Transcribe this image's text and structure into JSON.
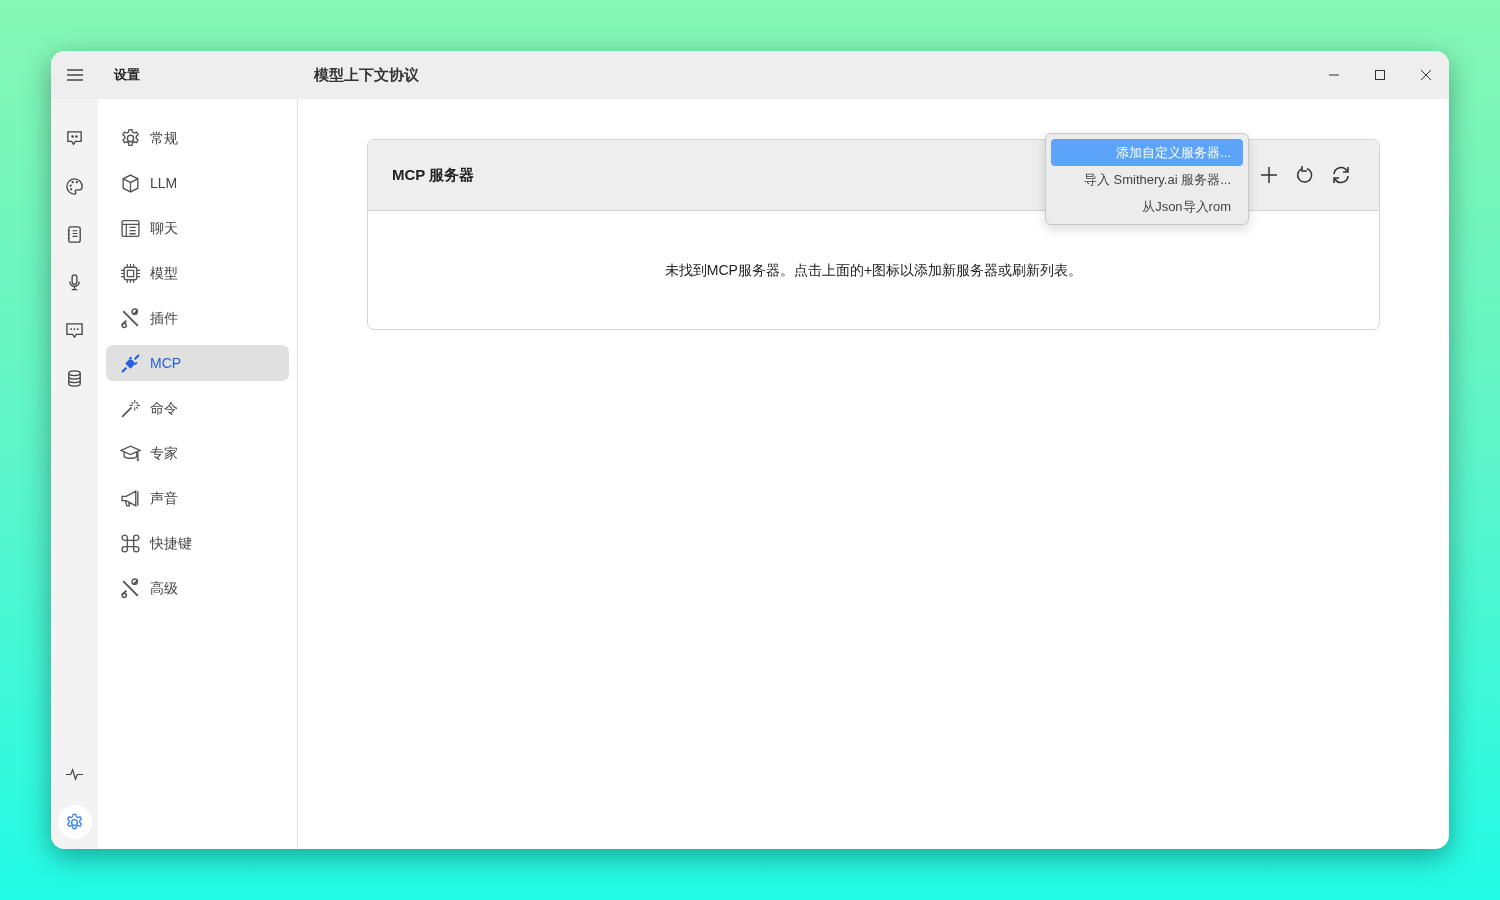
{
  "window": {
    "sidebar_title": "设置",
    "title": "模型上下文协议"
  },
  "rail": {
    "top": [
      {
        "kind": "chat-quote",
        "selected": false
      },
      {
        "kind": "palette",
        "selected": false
      },
      {
        "kind": "notebook",
        "selected": false
      },
      {
        "kind": "mic",
        "selected": false
      },
      {
        "kind": "chat-dots",
        "selected": false
      },
      {
        "kind": "database",
        "selected": false
      }
    ],
    "bottom": [
      {
        "kind": "pulse",
        "selected": false
      },
      {
        "kind": "gear",
        "selected": true
      }
    ]
  },
  "sidebar": {
    "items": [
      {
        "label": "常规",
        "kind": "gear",
        "selected": false
      },
      {
        "label": "LLM",
        "kind": "cube",
        "selected": false
      },
      {
        "label": "聊天",
        "kind": "layout",
        "selected": false
      },
      {
        "label": "模型",
        "kind": "chip",
        "selected": false
      },
      {
        "label": "插件",
        "kind": "tools",
        "selected": false
      },
      {
        "label": "MCP",
        "kind": "plug",
        "selected": true
      },
      {
        "label": "命令",
        "kind": "wand",
        "selected": false
      },
      {
        "label": "专家",
        "kind": "cap",
        "selected": false
      },
      {
        "label": "声音",
        "kind": "megaphone",
        "selected": false
      },
      {
        "label": "快捷键",
        "kind": "command",
        "selected": false
      },
      {
        "label": "高级",
        "kind": "tools",
        "selected": false
      }
    ]
  },
  "panel": {
    "title": "MCP 服务器",
    "empty_message": "未找到MCP服务器。点击上面的+图标以添加新服务器或刷新列表。",
    "menu": [
      {
        "label": "添加自定义服务器...",
        "selected": true
      },
      {
        "label": "导入 Smithery.ai 服务器...",
        "selected": false
      },
      {
        "label": "从Json导入rom",
        "selected": false
      }
    ]
  }
}
